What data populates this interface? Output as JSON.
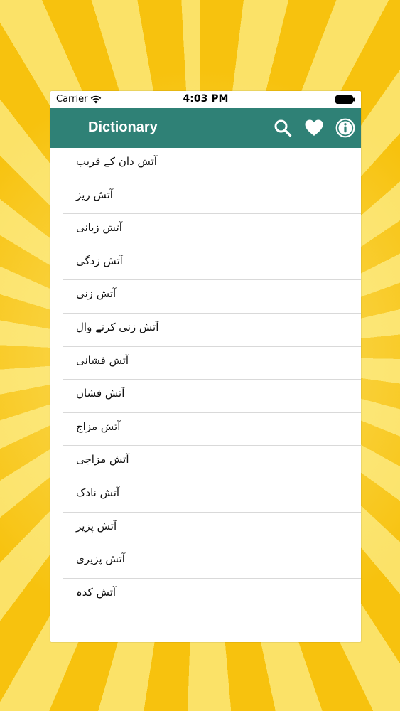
{
  "status_bar": {
    "carrier": "Carrier",
    "time": "4:03 PM"
  },
  "nav": {
    "title": "Dictionary",
    "icons": [
      "search-icon",
      "heart-icon",
      "info-icon"
    ]
  },
  "colors": {
    "nav_background": "#2f8176",
    "background_ray_dark": "#f7c20e",
    "background_ray_light": "#fbe268"
  },
  "words": [
    {
      "label": "آتش دان کے قریب"
    },
    {
      "label": "آتش ریز"
    },
    {
      "label": "آتش زبانی"
    },
    {
      "label": "آتش زدگی"
    },
    {
      "label": "آتش زنی"
    },
    {
      "label": "آتش زنی کرنے وال"
    },
    {
      "label": "آتش فشانی"
    },
    {
      "label": "آتش فشاں"
    },
    {
      "label": "آتش مزاج"
    },
    {
      "label": "آتش مزاجی"
    },
    {
      "label": "آتش نادک"
    },
    {
      "label": "آتش پزیر"
    },
    {
      "label": "آتش پزیری"
    },
    {
      "label": "آتش کدہ"
    }
  ]
}
